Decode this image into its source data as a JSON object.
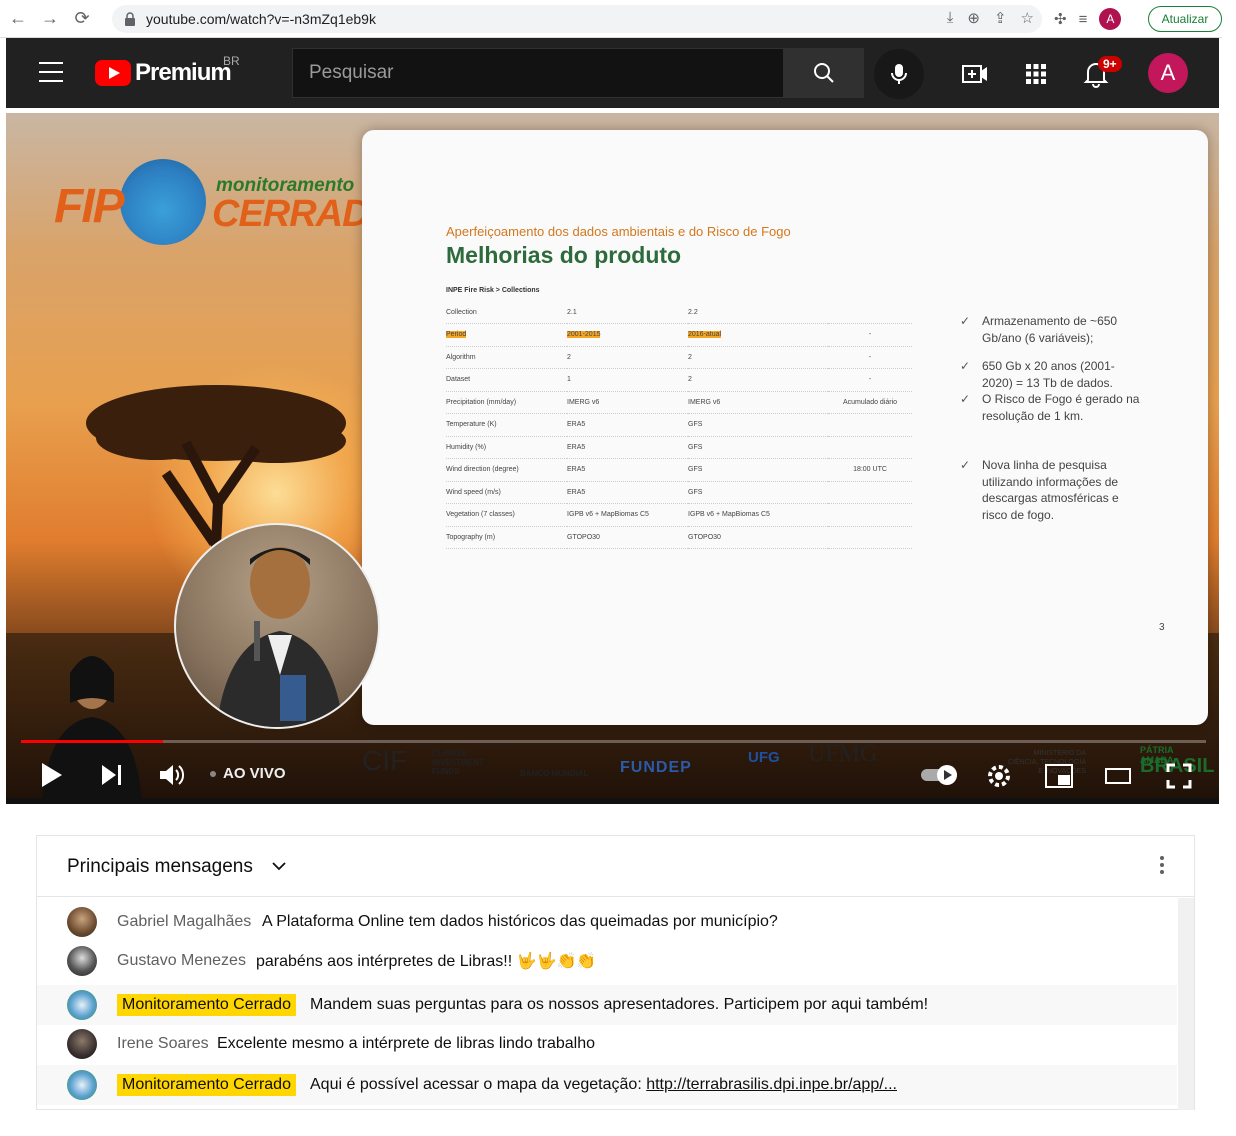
{
  "browser": {
    "url": "youtube.com/watch?v=-n3mZq1eb9k",
    "profile_initial": "A",
    "update_label": "Atualizar"
  },
  "header": {
    "logo_text": "Premium",
    "country_code": "BR",
    "search_placeholder": "Pesquisar",
    "notif_count": "9+",
    "avatar_initial": "A"
  },
  "video": {
    "brand": {
      "fip": "FIP",
      "monitoramento": "monitoramento",
      "cerrado": "CERRADO"
    },
    "slide": {
      "subtitle": "Aperfeiçoamento dos dados ambientais e do Risco de Fogo",
      "title": "Melhorias do produto",
      "breadcrumb": "INPE Fire Risk > Collections",
      "rows": [
        [
          "Collection",
          "2.1",
          "2.2",
          ""
        ],
        [
          "Period",
          "2001-2015",
          "2016-atual",
          "-"
        ],
        [
          "Algorithm",
          "2",
          "2",
          "-"
        ],
        [
          "Dataset",
          "1",
          "2",
          "-"
        ],
        [
          "Precipitation (mm/day)",
          "IMERG v6",
          "IMERG v6",
          "Acumulado diário"
        ],
        [
          "Temperature (K)",
          "ERA5",
          "GFS",
          ""
        ],
        [
          "Humidity (%)",
          "ERA5",
          "GFS",
          ""
        ],
        [
          "Wind direction (degree)",
          "ERA5",
          "GFS",
          "18:00 UTC"
        ],
        [
          "Wind speed (m/s)",
          "ERA5",
          "GFS",
          ""
        ],
        [
          "Vegetation (7 classes)",
          "IGPB v6 + MapBiomas C5",
          "IGPB v6 + MapBiomas C5",
          ""
        ],
        [
          "Topography (m)",
          "GTOPO30",
          "GTOPO30",
          ""
        ]
      ],
      "bullets": [
        "Armazenamento de ~650 Gb/ano (6 variáveis);",
        "650 Gb x 20 anos (2001-2020) = 13 Tb de dados.",
        "O Risco de Fogo é gerado na resolução de 1 km.",
        "Nova linha de pesquisa utilizando informações de descargas atmosféricas e risco de fogo."
      ],
      "page_number": "3"
    },
    "progress": 0.12,
    "live_label": "AO VIVO",
    "sponsors": {
      "cif": "CIF",
      "cif_sub": "CLIMATE INVESTMENT FUNDS",
      "banco": "BANCO MUNDIAL",
      "fundep": "FUNDEP",
      "ufg": "UFG",
      "ufmg": "UFMG",
      "ministerio": "MINISTÉRIO DA CIÊNCIA, TECNOLOGIA E INOVAÇÕES",
      "patria": "PÁTRIA AMADA",
      "brasil": "BRASIL"
    }
  },
  "chat": {
    "title": "Principais mensagens",
    "messages": [
      {
        "author": "Gabriel Magalhães",
        "text": "A Plataforma Online tem dados históricos das queimadas por município?",
        "owner": false
      },
      {
        "author": "Gustavo Menezes",
        "text": "parabéns aos intérpretes de Libras!! 🤟🤟👏👏",
        "owner": false
      },
      {
        "author": "Monitoramento Cerrado",
        "text": "Mandem suas perguntas para os nossos apresentadores. Participem por aqui também!",
        "owner": true
      },
      {
        "author": "Irene Soares",
        "text": "Excelente mesmo a intérprete de libras lindo trabalho",
        "owner": false
      },
      {
        "author": "Monitoramento Cerrado",
        "text": "Aqui é possível acessar o mapa da vegetação: ",
        "link": "http://terrabrasilis.dpi.inpe.br/app/...",
        "owner": true
      }
    ]
  }
}
